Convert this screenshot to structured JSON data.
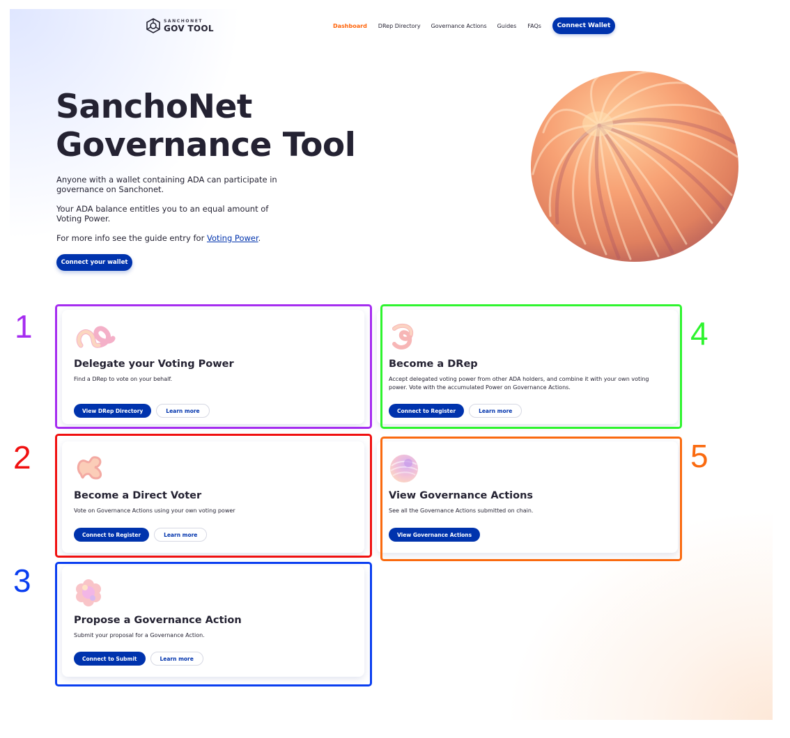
{
  "header": {
    "logo": {
      "small": "SANCHONET",
      "big": "GOV TOOL"
    },
    "nav": [
      {
        "label": "Dashboard",
        "active": true
      },
      {
        "label": "DRep Directory",
        "active": false
      },
      {
        "label": "Governance Actions",
        "active": false
      },
      {
        "label": "Guides",
        "active": false
      },
      {
        "label": "FAQs",
        "active": false
      }
    ],
    "connect_button": "Connect Wallet"
  },
  "hero": {
    "title_line1": "SanchoNet",
    "title_line2": "Governance Tool",
    "p1": "Anyone with a wallet containing ADA can participate in governance on Sanchonet.",
    "p2": "Your ADA balance entitles you to an equal amount of Voting Power.",
    "p3_prefix": "For more info see the guide entry for ",
    "p3_link": "Voting Power",
    "p3_suffix": ".",
    "button": "Connect your wallet"
  },
  "cards": {
    "delegate": {
      "title": "Delegate your Voting Power",
      "description": "Find a DRep to vote on your behalf.",
      "primary": "View DRep Directory",
      "secondary": "Learn more"
    },
    "direct_voter": {
      "title": "Become a Direct Voter",
      "description": "Vote on Governance Actions using your own voting power",
      "primary": "Connect to Register",
      "secondary": "Learn more"
    },
    "propose": {
      "title": "Propose a Governance Action",
      "description": "Submit your proposal for a Governance Action.",
      "primary": "Connect to Submit",
      "secondary": "Learn more"
    },
    "drep": {
      "title": "Become a DRep",
      "description": "Accept delegated voting power from other ADA holders, and combine it with your own voting power. Vote with the accumulated Power on Governance Actions.",
      "primary": "Connect to Register",
      "secondary": "Learn more"
    },
    "view_actions": {
      "title": "View Governance Actions",
      "description": "See all the Governance Actions submitted on chain.",
      "primary": "View Governance Actions"
    }
  },
  "annotations": [
    {
      "number": "1",
      "color": "#a52cf0"
    },
    {
      "number": "2",
      "color": "#f01010"
    },
    {
      "number": "3",
      "color": "#0a3ef0"
    },
    {
      "number": "4",
      "color": "#2ef42e"
    },
    {
      "number": "5",
      "color": "#fa6a0f"
    }
  ],
  "colors": {
    "accent": "#0033ad",
    "active_nav": "#ff640a",
    "text": "#242232"
  }
}
